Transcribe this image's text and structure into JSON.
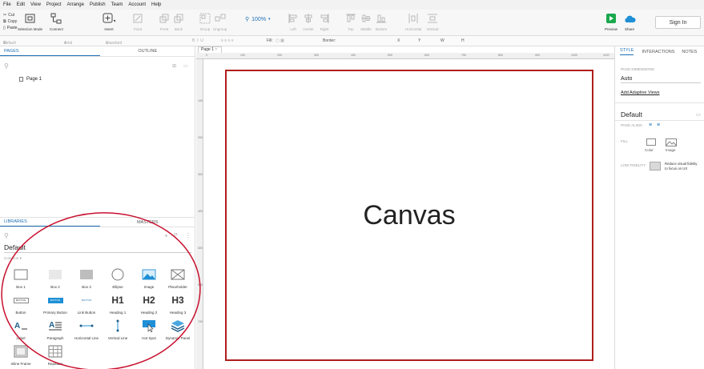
{
  "menu": [
    "File",
    "Edit",
    "View",
    "Project",
    "Arrange",
    "Publish",
    "Team",
    "Account",
    "Help"
  ],
  "clipboard": {
    "cut": "Cut",
    "copy": "Copy",
    "paste": "Paste"
  },
  "ribbon": {
    "selection_mode": "Selection Mode",
    "connect": "Connect",
    "insert": "Insert",
    "point": "Point",
    "front": "Front",
    "back": "Back",
    "group": "Group",
    "ungroup": "Ungroup",
    "zoom": "100%",
    "left": "Left",
    "center": "Center",
    "right": "Right",
    "top": "Top",
    "middle": "Middle",
    "bottom": "Bottom",
    "horizontal": "Horizontal",
    "vertical": "Vertical",
    "preview": "Preview",
    "share": "Share",
    "sign_in": "Sign In"
  },
  "format_bar": {
    "style": "Default",
    "font": "Arial",
    "weight": "Standard",
    "fill": "Fill:",
    "border": "Border:",
    "x": "X",
    "y": "Y",
    "w": "W",
    "h": "H"
  },
  "left_panel": {
    "tab_pages": "PAGES",
    "tab_outline": "OUTLINE",
    "page_item": "Page 1",
    "tab_libraries": "LIBRARIES",
    "tab_masters": "MASTERS",
    "library_name": "Default",
    "group_label": "Common ▾",
    "widgets": [
      {
        "label": "Box 1"
      },
      {
        "label": "Box 2"
      },
      {
        "label": "Box 3"
      },
      {
        "label": "Ellipse"
      },
      {
        "label": "Image"
      },
      {
        "label": "Placeholder"
      },
      {
        "label": "Button"
      },
      {
        "label": "Primary Button"
      },
      {
        "label": "Link Button"
      },
      {
        "label": "Heading 1"
      },
      {
        "label": "Heading 2"
      },
      {
        "label": "Heading 3"
      },
      {
        "label": "Label"
      },
      {
        "label": "Paragraph"
      },
      {
        "label": "Horizontal Line"
      },
      {
        "label": "Vertical Line"
      },
      {
        "label": "Hot Spot"
      },
      {
        "label": "Dynamic Panel"
      },
      {
        "label": "Inline Frame"
      },
      {
        "label": "Repeater"
      }
    ],
    "heading_glyphs": {
      "h1": "H1",
      "h2": "H2",
      "h3": "H3"
    },
    "button_glyphs": {
      "button": "BUTTON",
      "primary": "BUTTON",
      "link": "BUTTON"
    }
  },
  "canvas": {
    "tab": "Page 1",
    "ruler_h": [
      "0",
      "100",
      "200",
      "300",
      "400",
      "500",
      "600",
      "700",
      "800",
      "900",
      "1000",
      "1100"
    ],
    "ruler_v": [
      "100",
      "200",
      "300",
      "400",
      "500",
      "600",
      "700"
    ],
    "label": "Canvas"
  },
  "right_panel": {
    "tab_style": "STYLE",
    "tab_interactions": "INTERACTIONS",
    "tab_notes": "NOTES",
    "page_dimensions_label": "PAGE DIMENSIONS",
    "page_dimensions_value": "Auto",
    "adaptive_link": "Add Adaptive Views",
    "style_name": "Default",
    "page_align_label": "PAGE ALIGN",
    "fill_label": "FILL",
    "fill_color": "Color",
    "fill_image": "Image",
    "low_fidelity_label": "LOW FIDELITY",
    "low_fidelity_text_1": "Reduce visual fidelity",
    "low_fidelity_text_2": "to focus on UX"
  },
  "colors": {
    "accent": "#1f6fb5",
    "frame": "#b01d1d",
    "annotation": "#c8102e"
  }
}
